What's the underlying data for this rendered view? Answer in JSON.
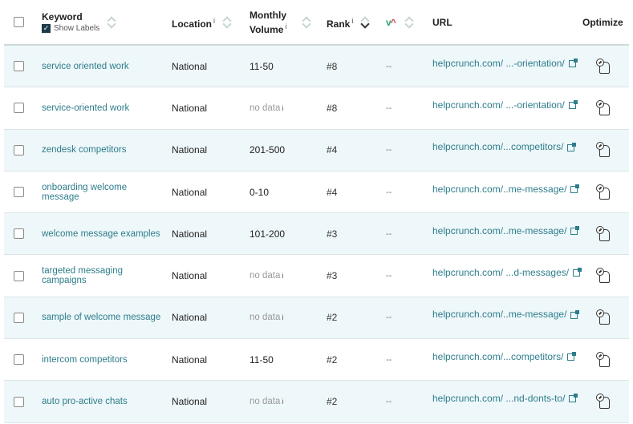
{
  "header": {
    "keyword": "Keyword",
    "show_labels": "Show Labels",
    "show_labels_checked": true,
    "location": "Location",
    "monthly_volume_line1": "Monthly",
    "monthly_volume_line2": "Volume",
    "rank": "Rank",
    "url": "URL",
    "optimize": "Optimize",
    "info_glyph": "i",
    "check_glyph": "✓",
    "trend_down_glyph": "✓",
    "trend_up_glyph": "^"
  },
  "rows": [
    {
      "keyword": "service oriented work",
      "location": "National",
      "volume": "11-50",
      "no_data": false,
      "rank": "#8",
      "change": "--",
      "url": "helpcrunch.com/ ...-orientation/"
    },
    {
      "keyword": "service-oriented work",
      "location": "National",
      "volume": "no data",
      "no_data": true,
      "rank": "#8",
      "change": "--",
      "url": "helpcrunch.com/ ...-orientation/"
    },
    {
      "keyword": "zendesk competitors",
      "location": "National",
      "volume": "201-500",
      "no_data": false,
      "rank": "#4",
      "change": "--",
      "url": "helpcrunch.com/...competitors/"
    },
    {
      "keyword": "onboarding welcome message",
      "location": "National",
      "volume": "0-10",
      "no_data": false,
      "rank": "#4",
      "change": "--",
      "url": "helpcrunch.com/..me-message/"
    },
    {
      "keyword": "welcome message examples",
      "location": "National",
      "volume": "101-200",
      "no_data": false,
      "rank": "#3",
      "change": "--",
      "url": "helpcrunch.com/..me-message/"
    },
    {
      "keyword": "targeted messaging campaigns",
      "location": "National",
      "volume": "no data",
      "no_data": true,
      "rank": "#3",
      "change": "--",
      "url": "helpcrunch.com/ ...d-messages/"
    },
    {
      "keyword": "sample of welcome message",
      "location": "National",
      "volume": "no data",
      "no_data": true,
      "rank": "#2",
      "change": "--",
      "url": "helpcrunch.com/..me-message/"
    },
    {
      "keyword": "intercom competitors",
      "location": "National",
      "volume": "11-50",
      "no_data": false,
      "rank": "#2",
      "change": "--",
      "url": "helpcrunch.com/...competitors/"
    },
    {
      "keyword": "auto pro-active chats",
      "location": "National",
      "volume": "no data",
      "no_data": true,
      "rank": "#2",
      "change": "--",
      "url": "helpcrunch.com/ ...nd-donts-to/"
    }
  ],
  "colors": {
    "accent_link": "#2e7d8c",
    "row_alt_bg": "#eef7f9",
    "trend_up": "#c0504d",
    "trend_down": "#2aa57a"
  }
}
